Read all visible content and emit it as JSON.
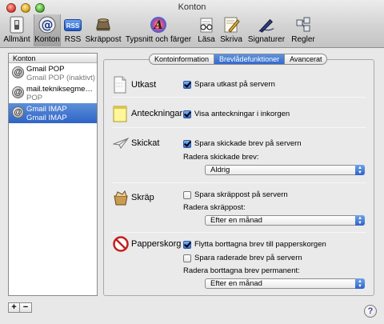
{
  "window": {
    "title": "Konton"
  },
  "toolbar": {
    "items": [
      {
        "label": "Allmänt",
        "icon": "switch-icon"
      },
      {
        "label": "Konton",
        "icon": "at-sign-icon"
      },
      {
        "label": "RSS",
        "icon": "rss-icon"
      },
      {
        "label": "Skräppost",
        "icon": "junk-mail-icon"
      },
      {
        "label": "Typsnitt och färger",
        "icon": "fonts-icon"
      },
      {
        "label": "Läsa",
        "icon": "glasses-icon"
      },
      {
        "label": "Skriva",
        "icon": "pencil-icon"
      },
      {
        "label": "Signaturer",
        "icon": "fountain-pen-icon"
      },
      {
        "label": "Regler",
        "icon": "rules-icon"
      }
    ],
    "selected": "Konton",
    "rss_badge": "RSS"
  },
  "sidebar": {
    "header": "Konton",
    "accounts": [
      {
        "name": "Gmail POP",
        "detail": "Gmail POP (inaktivt)"
      },
      {
        "name": "mail.tekniksegme…",
        "detail": "POP"
      },
      {
        "name": "Gmail IMAP",
        "detail": "Gmail IMAP"
      }
    ],
    "selected_index": 2,
    "add_label": "+",
    "remove_label": "−"
  },
  "tabs": [
    {
      "label": "Kontoinformation"
    },
    {
      "label": "Brevlådefunktioner"
    },
    {
      "label": "Avancerat"
    }
  ],
  "active_tab": "Brevlådefunktioner",
  "sections": {
    "drafts": {
      "title": "Utkast",
      "checkbox": {
        "label": "Spara utkast på servern",
        "checked": true
      }
    },
    "notes": {
      "title": "Anteckningar",
      "checkbox": {
        "label": "Visa anteckningar i inkorgen",
        "checked": true
      }
    },
    "sent": {
      "title": "Skickat",
      "checkbox": {
        "label": "Spara skickade brev på servern",
        "checked": true
      },
      "delete_label": "Radera skickade brev:",
      "delete_value": "Aldrig"
    },
    "junk": {
      "title": "Skräp",
      "checkbox": {
        "label": "Spara skräppost på servern",
        "checked": false
      },
      "delete_label": "Radera skräppost:",
      "delete_value": "Efter en månad"
    },
    "trash": {
      "title": "Papperskorg",
      "checkbox1": {
        "label": "Flytta borttagna brev till papperskorgen",
        "checked": true
      },
      "checkbox2": {
        "label": "Spara raderade brev på servern",
        "checked": false
      },
      "delete_label": "Radera borttagna brev permanent:",
      "delete_value": "Efter en månad"
    }
  },
  "help": {
    "label": "?"
  },
  "colors": {
    "selection": "#3368cc",
    "accent": "#5d93dd"
  }
}
